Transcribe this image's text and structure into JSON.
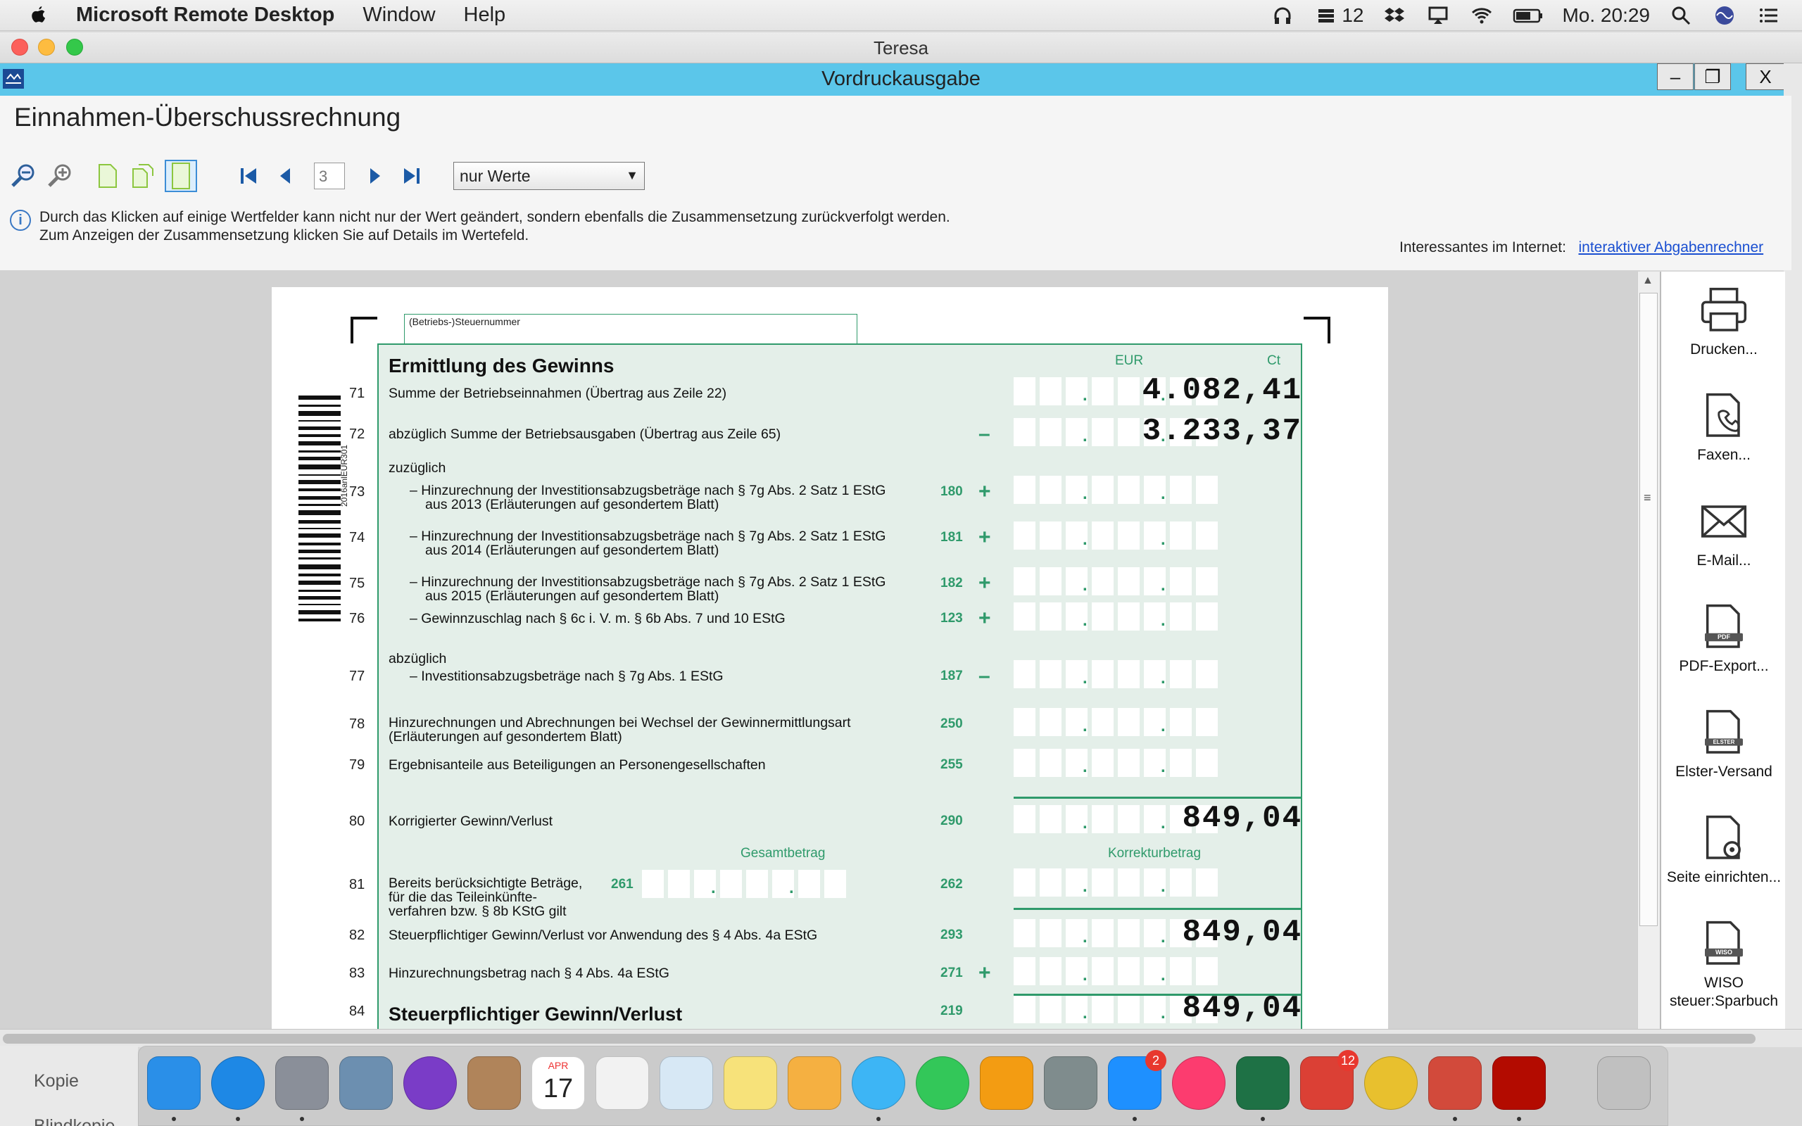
{
  "menubar": {
    "app_name": "Microsoft Remote Desktop",
    "menus": [
      "Window",
      "Help"
    ],
    "notif_count": "12",
    "clock": "Mo. 20:29"
  },
  "window": {
    "title": "Teresa"
  },
  "app": {
    "title": "Vordruckausgabe",
    "heading": "Einnahmen-Überschussrechnung",
    "minimize": "–",
    "restore": "❐",
    "close": "X"
  },
  "toolbar": {
    "page": "3",
    "view_select": "nur Werte"
  },
  "info": {
    "line1": "Durch das Klicken auf einige Wertfelder kann nicht nur der Wert geändert, sondern ebenfalls die Zusammensetzung zurückverfolgt werden.",
    "line2": "Zum Anzeigen der Zusammensetzung klicken Sie auf Details im Wertefeld.",
    "internet_label": "Interessantes im Internet:",
    "internet_link": "interaktiver Abgabenrechner"
  },
  "form": {
    "steuernummer_label": "(Betriebs-)Steuernummer",
    "section_title": "Ermittlung des Gewinns",
    "col_eur": "EUR",
    "col_ct": "Ct",
    "zuzueglich": "zuzüglich",
    "abzueglich": "abzüglich",
    "gesamtbetrag": "Gesamtbetrag",
    "korrekturbetrag": "Korrekturbetrag",
    "barcode_text": "2016anlEUR301",
    "rows": [
      {
        "no": "71",
        "label": "Summe der Betriebseinnahmen (Übertrag aus Zeile 22)",
        "kz": "",
        "sign": "",
        "value": "4.082,41"
      },
      {
        "no": "72",
        "label": "abzüglich Summe der Betriebsausgaben (Übertrag aus Zeile 65)",
        "kz": "",
        "sign": "–",
        "value": "3.233,37"
      },
      {
        "no": "73",
        "label": "–  Hinzurechnung der Investitionsabzugsbeträge nach § 7g Abs. 2 Satz 1 EStG",
        "label2": "aus 2013 (Erläuterungen auf gesondertem Blatt)",
        "kz": "180",
        "sign": "+",
        "value": ""
      },
      {
        "no": "74",
        "label": "–  Hinzurechnung der Investitionsabzugsbeträge nach § 7g Abs. 2 Satz 1 EStG",
        "label2": "aus 2014 (Erläuterungen auf gesondertem Blatt)",
        "kz": "181",
        "sign": "+",
        "value": ""
      },
      {
        "no": "75",
        "label": "–  Hinzurechnung der Investitionsabzugsbeträge nach § 7g Abs. 2 Satz 1 EStG",
        "label2": "aus 2015 (Erläuterungen auf gesondertem Blatt)",
        "kz": "182",
        "sign": "+",
        "value": ""
      },
      {
        "no": "76",
        "label": "–  Gewinnzuschlag nach § 6c i. V. m. § 6b Abs. 7 und 10 EStG",
        "kz": "123",
        "sign": "+",
        "value": ""
      },
      {
        "no": "77",
        "label": "–  Investitionsabzugsbeträge nach § 7g Abs. 1 EStG",
        "kz": "187",
        "sign": "–",
        "value": ""
      },
      {
        "no": "78",
        "label": "Hinzurechnungen und Abrechnungen bei Wechsel der Gewinnermittlungsart",
        "label2": "(Erläuterungen auf gesondertem Blatt)",
        "kz": "250",
        "sign": "",
        "value": ""
      },
      {
        "no": "79",
        "label": "Ergebnisanteile aus Beteiligungen an Personengesellschaften",
        "kz": "255",
        "sign": "",
        "value": ""
      },
      {
        "no": "80",
        "label": "Korrigierter Gewinn/Verlust",
        "kz": "290",
        "sign": "",
        "value": "849,04"
      },
      {
        "no": "81",
        "label": "Bereits berücksichtigte Beträge,",
        "label2": "für die das Teileinkünfte-",
        "label3": "verfahren bzw. § 8b KStG gilt",
        "kz": "262",
        "kz_left": "261",
        "sign": "",
        "value": ""
      },
      {
        "no": "82",
        "label": "Steuerpflichtiger Gewinn/Verlust vor Anwendung des § 4 Abs. 4a EStG",
        "kz": "293",
        "sign": "",
        "value": "849,04"
      },
      {
        "no": "83",
        "label": "Hinzurechnungsbetrag nach § 4 Abs. 4a EStG",
        "kz": "271",
        "sign": "+",
        "value": ""
      },
      {
        "no": "84",
        "label": "Steuerpflichtiger Gewinn/Verlust",
        "kz": "219",
        "sign": "",
        "value": "849,04"
      }
    ]
  },
  "actions": [
    {
      "label": "Drucken...",
      "icon": "printer-icon"
    },
    {
      "label": "Faxen...",
      "icon": "fax-icon"
    },
    {
      "label": "E-Mail...",
      "icon": "mail-icon"
    },
    {
      "label": "PDF-Export...",
      "icon": "pdf-icon",
      "badge": "PDF"
    },
    {
      "label": "Elster-Versand",
      "icon": "elster-icon",
      "badge": "ELSTER"
    },
    {
      "label": "Seite einrichten...",
      "icon": "page-setup-icon"
    },
    {
      "label": "WISO steuer:Sparbuch",
      "icon": "wiso-icon",
      "badge": "WISO"
    }
  ],
  "mail_sidebar": {
    "items": [
      "Kopie",
      "Blindkopie"
    ]
  },
  "dock": {
    "calendar_month": "APR",
    "calendar_day": "17",
    "appstore_badge": "2",
    "todoist_badge": "12",
    "colors": [
      "#2a8fe8",
      "#1e88e5",
      "#8a8f99",
      "#6c8fb0",
      "#7a3cc7",
      "#b0845a",
      "#ffffff",
      "#f2f2f2",
      "#d7e8f5",
      "#f7e27a",
      "#f5b041",
      "#3db5f5",
      "#33c759",
      "#f39c12",
      "#7f8c8d",
      "#1e90ff",
      "#fc3c6f",
      "#1e7145",
      "#db4035",
      "#e8c02e",
      "#d24a3b",
      "#b30b00",
      "#c0c0c0"
    ]
  }
}
